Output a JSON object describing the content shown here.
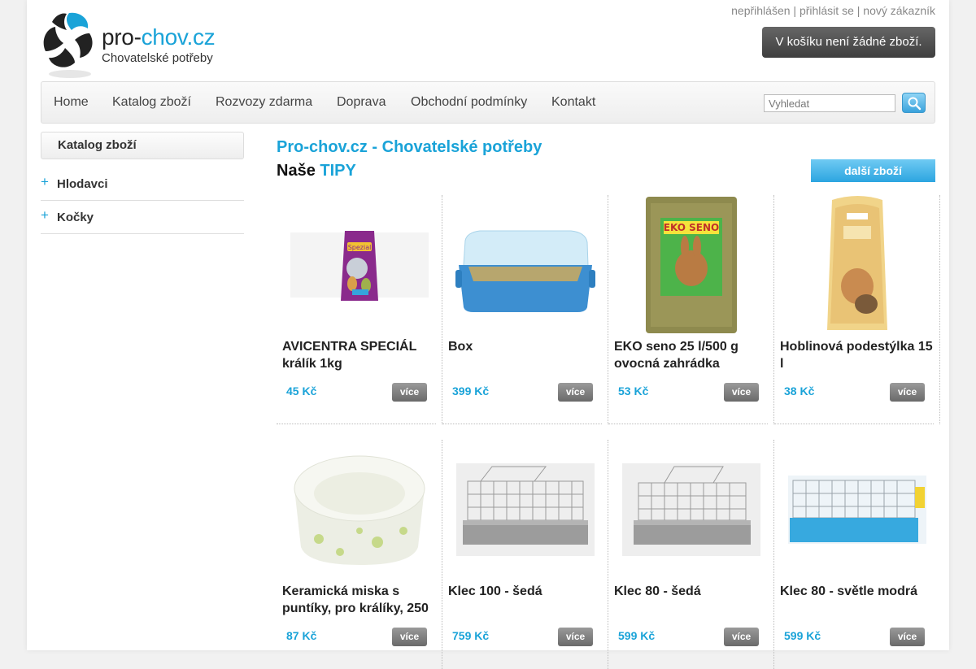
{
  "header": {
    "logo_main_a": "pro-",
    "logo_main_b": "chov.cz",
    "logo_sub": "Chovatelské potřeby",
    "user_status": "nepřihlášen",
    "login_link": "přihlásit se",
    "register_link": "nový zákazník",
    "separator": "|",
    "cart_text": "V košíku není žádné zboží."
  },
  "nav": {
    "items": [
      "Home",
      "Katalog zboží",
      "Rozvozy zdarma",
      "Doprava",
      "Obchodní podmínky",
      "Kontakt"
    ],
    "search_placeholder": "Vyhledat"
  },
  "sidebar": {
    "title": "Katalog zboží",
    "items": [
      {
        "label": "Hlodavci",
        "marker": "+"
      },
      {
        "label": "Kočky",
        "marker": "+"
      }
    ]
  },
  "main": {
    "title": "Pro-chov.cz - Chovatelské potřeby",
    "tips_prefix": "Naše",
    "tips_accent": "TIPY",
    "more_button": "další zboží",
    "products": [
      {
        "name": "AVICENTRA SPECIÁL králík 1kg",
        "price": "45 Kč",
        "button": "více",
        "icon": "food-bag-icon"
      },
      {
        "name": "Box",
        "price": "399 Kč",
        "button": "více",
        "icon": "box-icon"
      },
      {
        "name": "EKO seno 25 l/500 g ovocná zahrádka",
        "price": "53 Kč",
        "button": "více",
        "icon": "hay-bag-icon"
      },
      {
        "name": "Hoblinová podestýlka 15 l",
        "price": "38 Kč",
        "button": "více",
        "icon": "bedding-bag-icon"
      },
      {
        "name": "Keramická miska s puntíky, pro králíky, 250",
        "price": "87 Kč",
        "button": "více",
        "icon": "bowl-icon"
      },
      {
        "name": "Klec 100 - šedá",
        "price": "759 Kč",
        "button": "více",
        "icon": "cage-grey-icon"
      },
      {
        "name": "Klec 80 - šedá",
        "price": "599 Kč",
        "button": "více",
        "icon": "cage-grey-icon"
      },
      {
        "name": "Klec 80 - světle modrá",
        "price": "599 Kč",
        "button": "více",
        "icon": "cage-blue-icon"
      }
    ],
    "product_image_labels": {
      "food_bag": "Spezial",
      "hay_bag": "EKO SENO"
    }
  },
  "colors": {
    "accent": "#1aa3d8",
    "text": "#222222",
    "button_grey": "#7a7a7a"
  }
}
